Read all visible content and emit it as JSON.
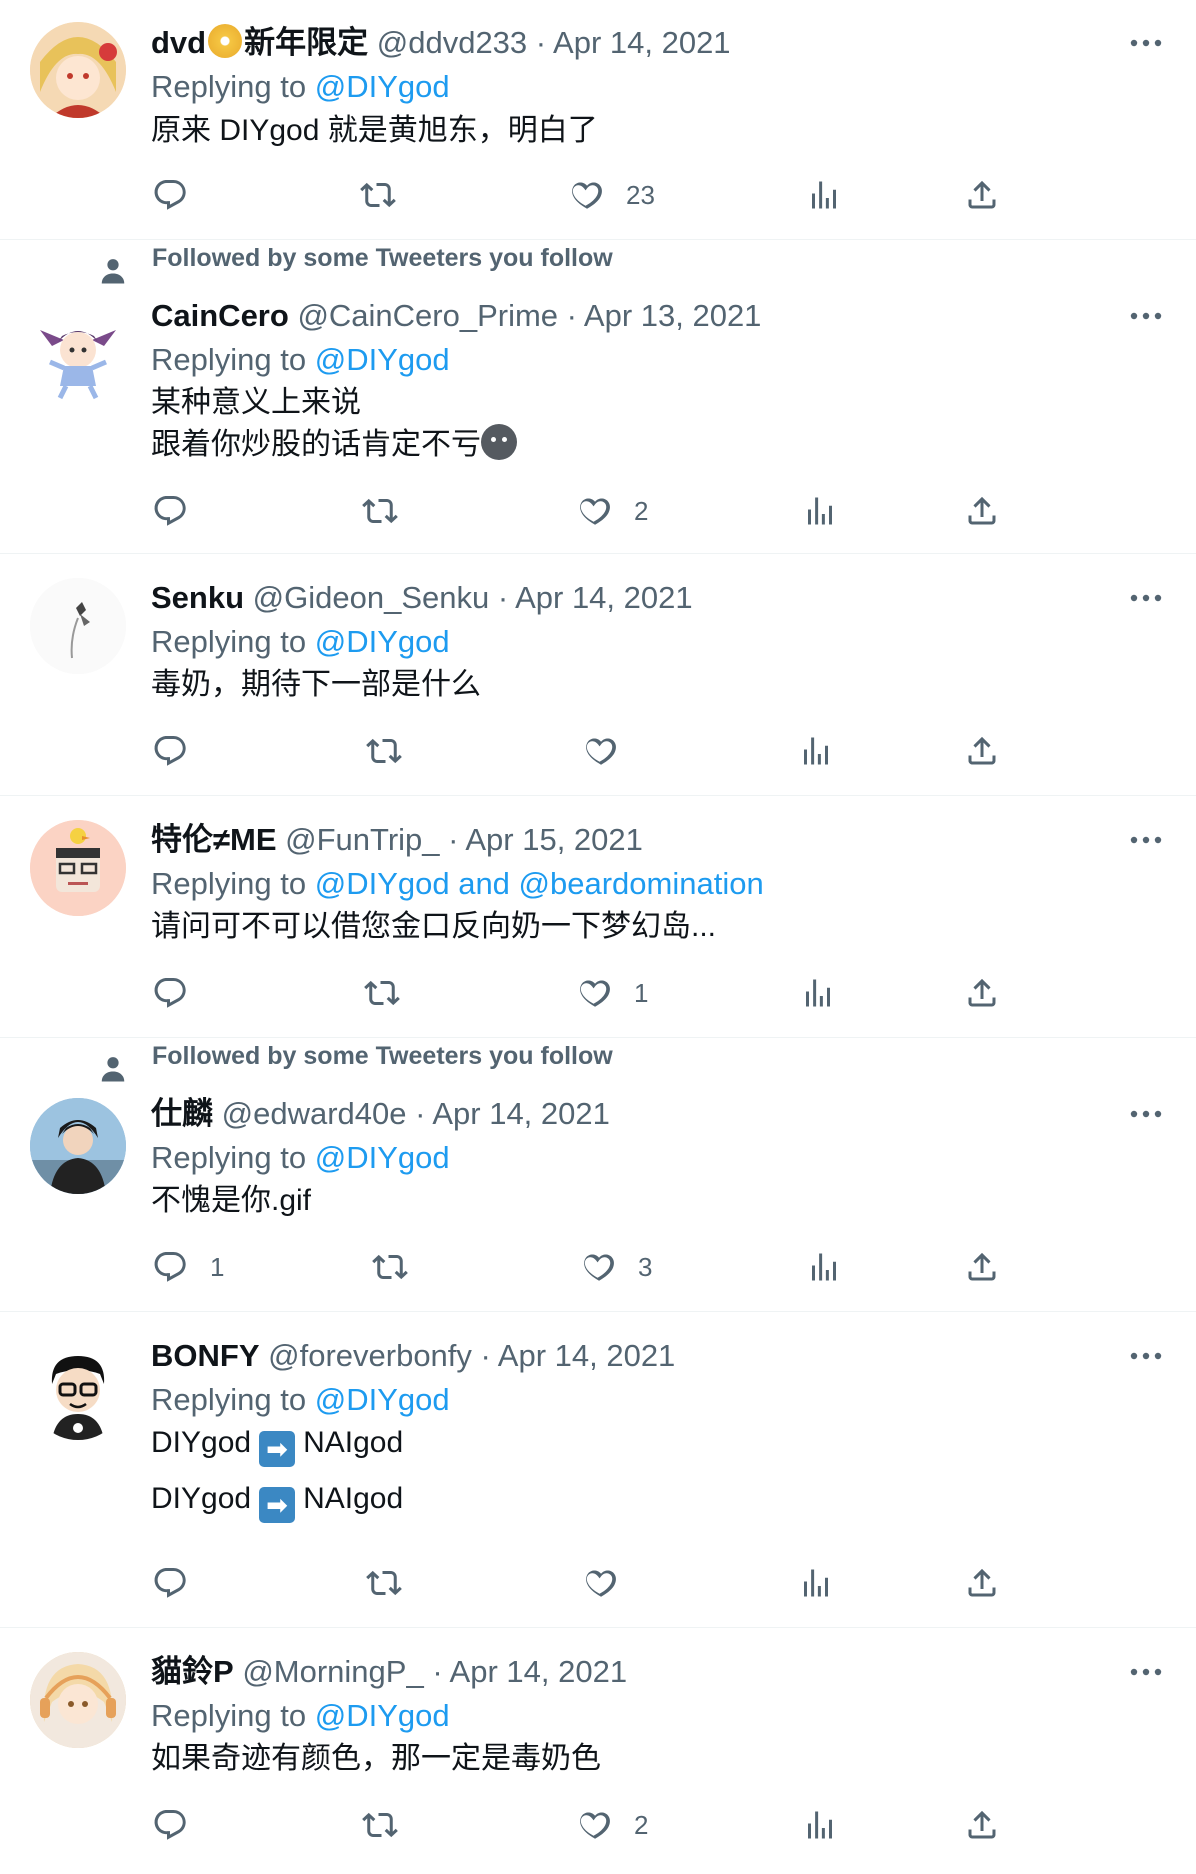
{
  "social_context_label": "Followed by some Tweeters you follow",
  "reply_prefix": "Replying to",
  "tweets": [
    {
      "name": "dvd",
      "name_suffix": "新年限定",
      "handle": "@ddvd233",
      "date": "· Apr 14, 2021",
      "replying_to": "@DIYgod",
      "lines": [
        "原来 DIYgod 就是黄旭东，明白了"
      ],
      "counts": {
        "reply": "",
        "retweet": "",
        "like": "23"
      },
      "avatar_color": "#f5d9b4"
    },
    {
      "name": "CainCero",
      "handle": "@CainCero_Prime",
      "date": "· Apr 13, 2021",
      "replying_to": "@DIYgod",
      "lines": [
        "某种意义上来说",
        "跟着你炒股的话肯定不亏"
      ],
      "counts": {
        "reply": "",
        "retweet": "",
        "like": "2"
      },
      "avatar_color": "#ffffff"
    },
    {
      "name": "Senku",
      "handle": "@Gideon_Senku",
      "date": "· Apr 14, 2021",
      "replying_to": "@DIYgod",
      "lines": [
        "毒奶，期待下一部是什么"
      ],
      "counts": {
        "reply": "",
        "retweet": "",
        "like": ""
      },
      "avatar_color": "#f7f7f7"
    },
    {
      "name": "特伦≠ME",
      "handle": "@FunTrip_",
      "date": "· Apr 15, 2021",
      "replying_to": "@DIYgod and @beardomination",
      "lines": [
        "请问可不可以借您金口反向奶一下梦幻岛..."
      ],
      "counts": {
        "reply": "",
        "retweet": "",
        "like": "1"
      },
      "avatar_color": "#fbd3c4"
    },
    {
      "name": "仕麟",
      "handle": "@edward40e",
      "date": "· Apr 14, 2021",
      "replying_to": "@DIYgod",
      "lines": [
        "不愧是你.gif"
      ],
      "counts": {
        "reply": "1",
        "retweet": "",
        "like": "3"
      },
      "avatar_color": "#8fb6d8"
    },
    {
      "name": "BONFY",
      "handle": "@foreverbonfy",
      "date": "· Apr 14, 2021",
      "replying_to": "@DIYgod",
      "lines_arrow": [
        {
          "left": "DIYgod",
          "right": "NAIgod"
        },
        {
          "left": "DIYgod",
          "right": "NAIgod"
        }
      ],
      "counts": {
        "reply": "",
        "retweet": "",
        "like": ""
      },
      "avatar_color": "#ffffff"
    },
    {
      "name": "貓鈴P",
      "handle": "@MorningP_",
      "date": "· Apr 14, 2021",
      "replying_to": "@DIYgod",
      "lines": [
        "如果奇迹有颜色，那一定是毒奶色"
      ],
      "counts": {
        "reply": "",
        "retweet": "",
        "like": "2"
      },
      "avatar_color": "#e8cfa6"
    }
  ]
}
